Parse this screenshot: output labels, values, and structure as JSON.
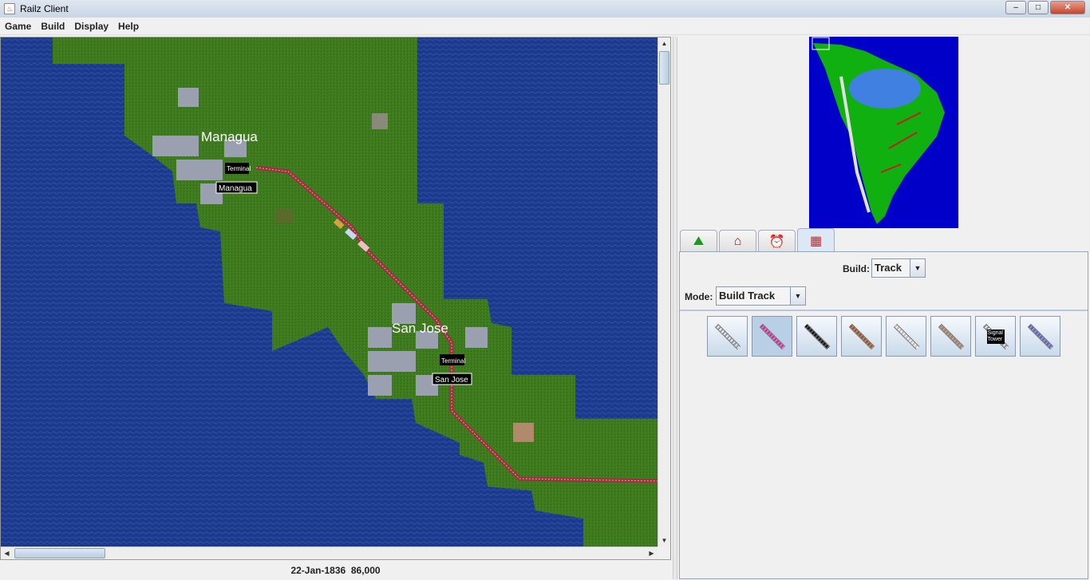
{
  "window": {
    "title": "Railz Client",
    "minimize": "–",
    "maximize": "□",
    "close": "✕"
  },
  "menu": [
    "Game",
    "Build",
    "Display",
    "Help"
  ],
  "map": {
    "cities": [
      {
        "name": "Managua",
        "station_type": "Terminal",
        "station_name": "Managua"
      },
      {
        "name": "San Jose",
        "station_type": "Terminal",
        "station_name": "San Jose"
      }
    ],
    "colors": {
      "water": "#1c3a8c",
      "land": "#3e7a1e",
      "track": "#a03040"
    }
  },
  "status": {
    "date": "22-Jan-1836",
    "money": "86,000"
  },
  "tabs": [
    {
      "icon": "terrain-info-icon"
    },
    {
      "icon": "station-info-icon"
    },
    {
      "icon": "alarm-clock-icon"
    },
    {
      "icon": "build-brick-icon",
      "active": true
    }
  ],
  "build_panel": {
    "build_label": "Build:",
    "build_value": "Track",
    "mode_label": "Mode:",
    "mode_value": "Build Track",
    "tools": [
      {
        "name": "standard-track",
        "color": "#999"
      },
      {
        "name": "electric-track",
        "color": "#c03090",
        "selected": true
      },
      {
        "name": "double-track",
        "color": "#111"
      },
      {
        "name": "viaduct",
        "color": "#8a5030"
      },
      {
        "name": "steel-bridge",
        "color": "#bbb"
      },
      {
        "name": "tunnel",
        "color": "#9a8070"
      },
      {
        "name": "signal-tower",
        "color": "#000",
        "label": "Signal Tower"
      },
      {
        "name": "double-electric-track",
        "color": "#6060b0"
      }
    ]
  }
}
